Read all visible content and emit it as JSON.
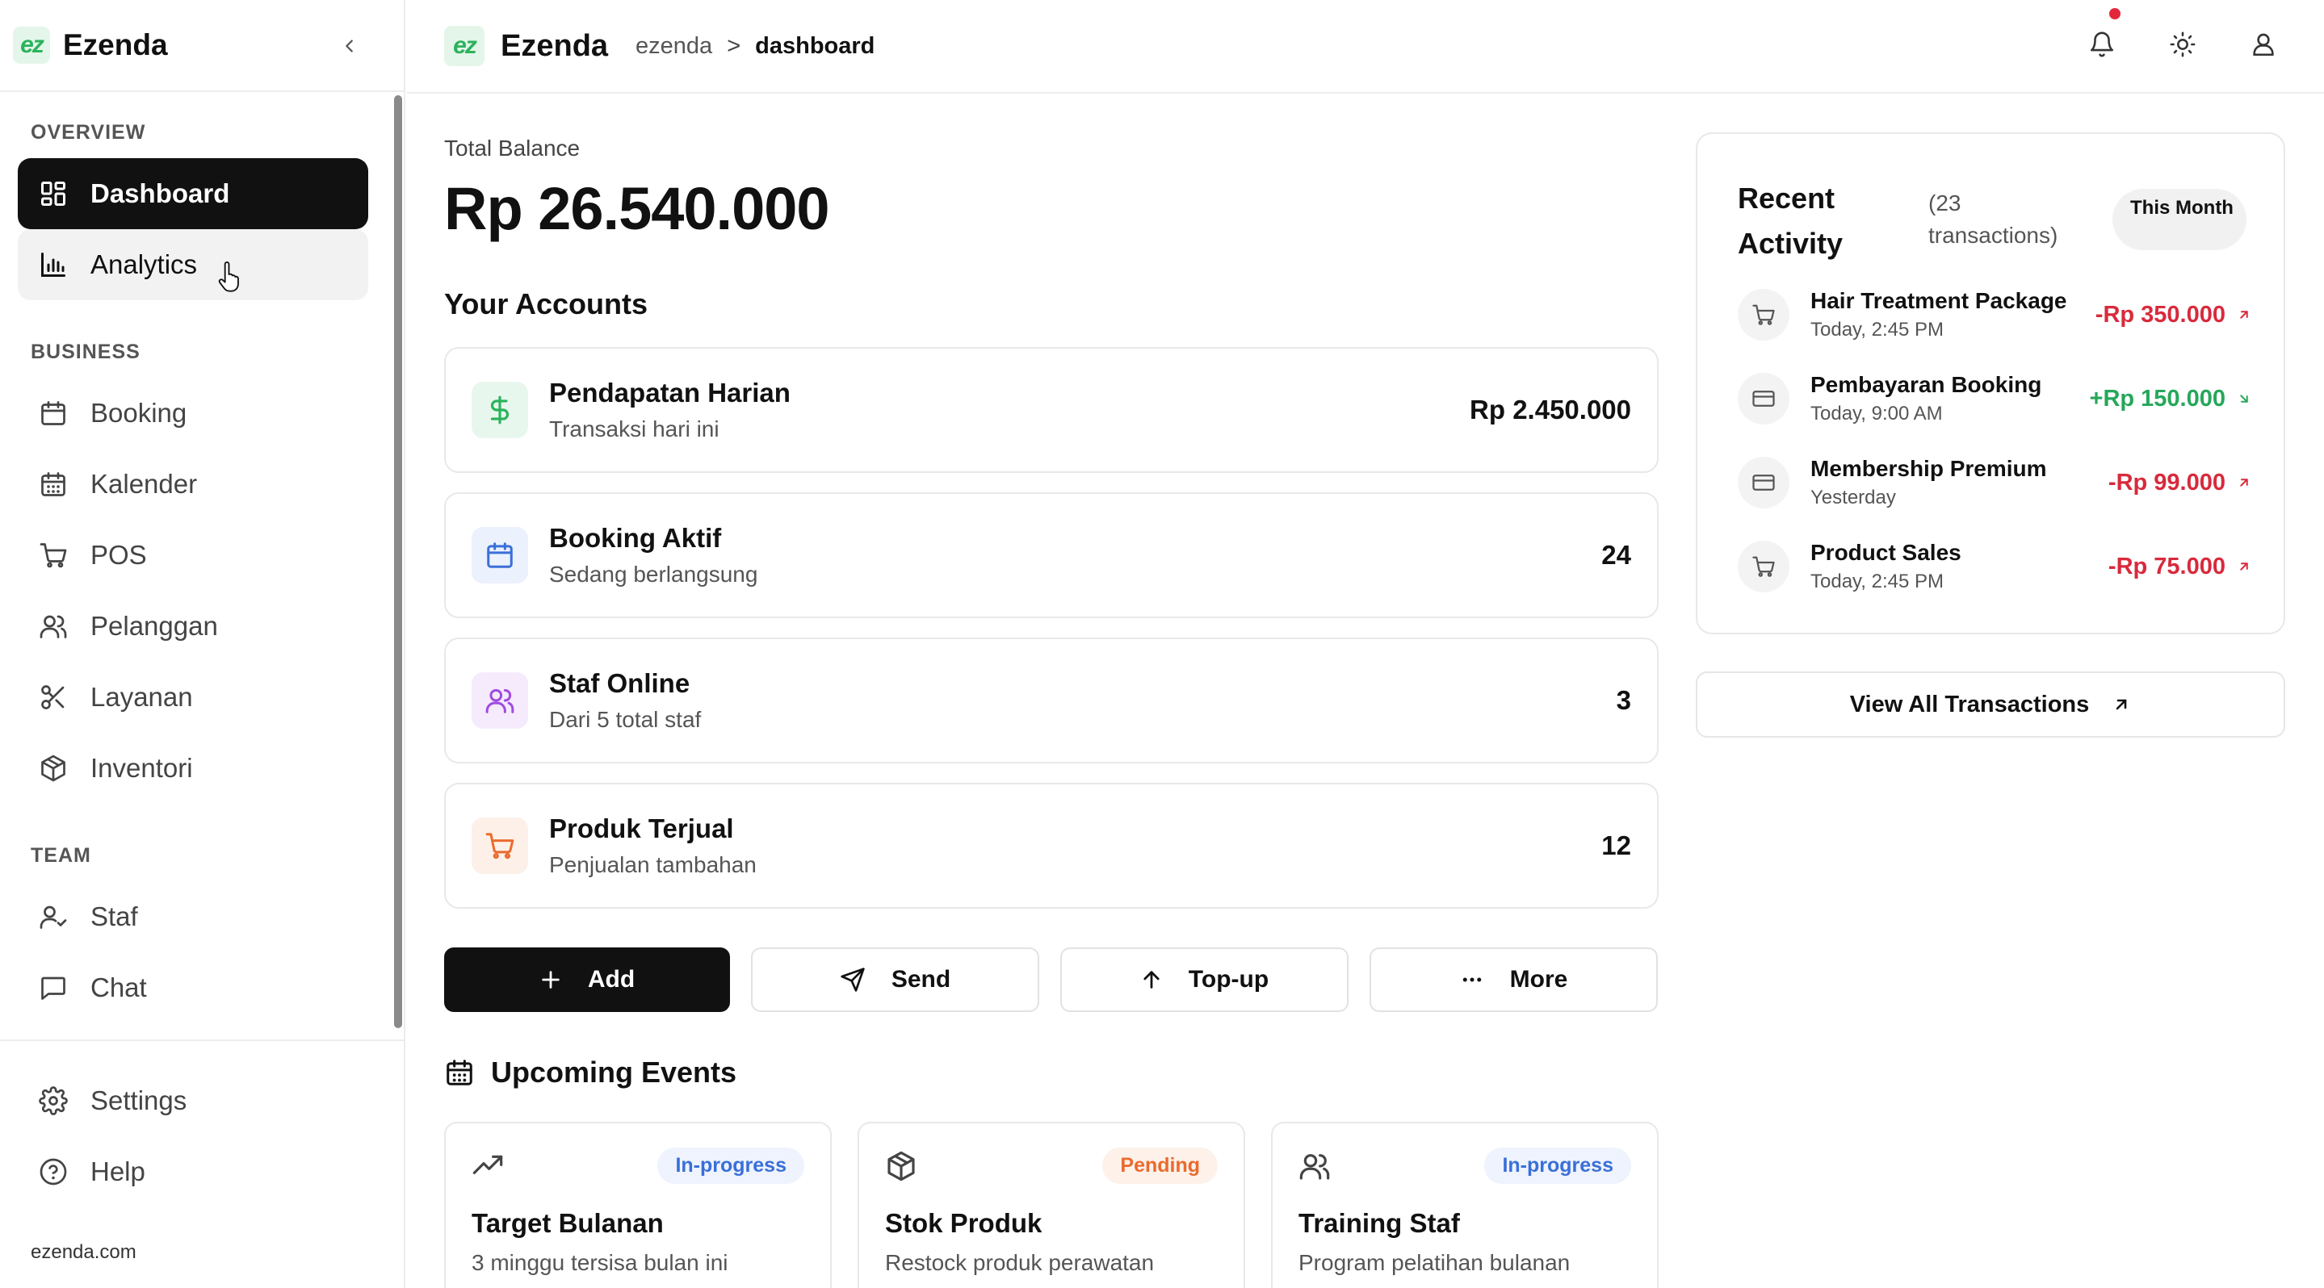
{
  "brand": {
    "badge": "ez",
    "name": "Ezenda"
  },
  "sidebar": {
    "sections": {
      "overview": "OVERVIEW",
      "business": "BUSINESS",
      "team": "TEAM"
    },
    "items": {
      "dashboard": "Dashboard",
      "analytics": "Analytics",
      "booking": "Booking",
      "kalender": "Kalender",
      "pos": "POS",
      "pelanggan": "Pelanggan",
      "layanan": "Layanan",
      "inventori": "Inventori",
      "staf": "Staf",
      "chat": "Chat",
      "settings": "Settings",
      "help": "Help"
    },
    "active": "Dashboard",
    "footer_domain": "ezenda.com"
  },
  "header": {
    "breadcrumb": {
      "root": "ezenda",
      "separator": ">",
      "current": "dashboard"
    },
    "icons": [
      "bell-icon",
      "sun-icon",
      "user-icon"
    ],
    "notification_dot_color": "#e5273b"
  },
  "balance": {
    "label": "Total Balance",
    "amount": "Rp 26.540.000"
  },
  "accounts": {
    "title": "Your Accounts",
    "items": [
      {
        "name": "Pendapatan Harian",
        "sub": "Transaksi hari ini",
        "value": "Rp 2.450.000",
        "icon": "dollar-icon",
        "color": "#2bb35c"
      },
      {
        "name": "Booking Aktif",
        "sub": "Sedang berlangsung",
        "value": "24",
        "icon": "calendar-icon",
        "color": "#3a6fd8"
      },
      {
        "name": "Staf Online",
        "sub": "Dari 5 total staf",
        "value": "3",
        "icon": "users-icon",
        "color": "#a04be0"
      },
      {
        "name": "Produk Terjual",
        "sub": "Penjualan tambahan",
        "value": "12",
        "icon": "cart-icon",
        "color": "#ea6b2d"
      }
    ]
  },
  "actions": {
    "add": "Add",
    "send": "Send",
    "topup": "Top-up",
    "more": "More"
  },
  "events": {
    "title": "Upcoming Events",
    "items": [
      {
        "title": "Target Bulanan",
        "sub": "3 minggu tersisa bulan ini",
        "status": "In-progress",
        "icon": "trending-up-icon"
      },
      {
        "title": "Stok Produk",
        "sub": "Restock produk perawatan",
        "status": "Pending",
        "icon": "package-icon"
      },
      {
        "title": "Training Staf",
        "sub": "Program pelatihan bulanan",
        "status": "In-progress",
        "icon": "users-icon"
      }
    ]
  },
  "activity": {
    "title": "Recent Activity",
    "count": "(23 transactions)",
    "period": "This Month",
    "items": [
      {
        "name": "Hair Treatment Package",
        "time": "Today, 2:45 PM",
        "amount": "-Rp 350.000",
        "icon": "cart-icon",
        "direction": "out"
      },
      {
        "name": "Pembayaran Booking",
        "time": "Today, 9:00 AM",
        "amount": "+Rp 150.000",
        "icon": "card-icon",
        "direction": "in"
      },
      {
        "name": "Membership Premium",
        "time": "Yesterday",
        "amount": "-Rp 99.000",
        "icon": "card-icon",
        "direction": "out"
      },
      {
        "name": "Product Sales",
        "time": "Today, 2:45 PM",
        "amount": "-Rp 75.000",
        "icon": "cart-icon",
        "direction": "out"
      }
    ],
    "view_all": "View All Transactions"
  }
}
